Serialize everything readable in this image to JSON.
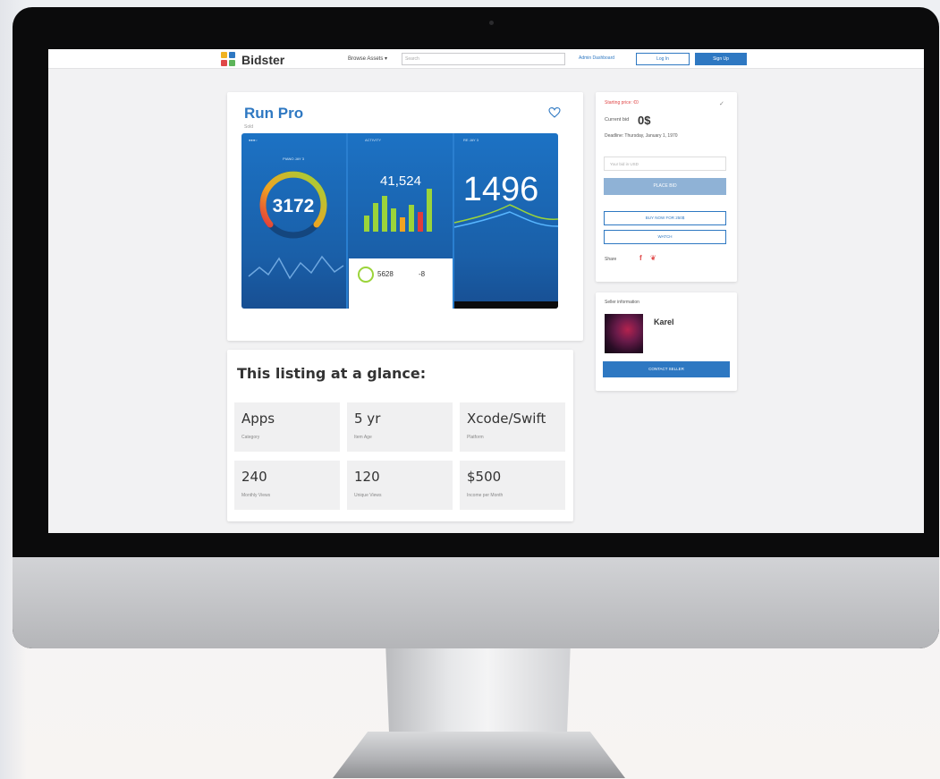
{
  "navbar": {
    "brand": "Bidster",
    "browse_label": "Browse Assets ▾",
    "search_placeholder": "Search",
    "admin_label": "Admin Dashboard",
    "login_label": "Log In",
    "signup_label": "Sign Up"
  },
  "listing": {
    "title": "Run Pro",
    "subtitle": "Sold",
    "hero": {
      "left_label": "●●●○",
      "left_caption": "PIANO  JAY 3",
      "gauge_value": "3172",
      "mid_label": "ACTIVITY",
      "mid_value": "41,524",
      "right_label": "RE  JAY 3",
      "right_value": "1496",
      "card_a": "5628",
      "card_b": "-8"
    }
  },
  "glance": {
    "title": "This listing at a glance:",
    "tiles": [
      {
        "value": "Apps",
        "label": "Category"
      },
      {
        "value": "5 yr",
        "label": "Item Age"
      },
      {
        "value": "Xcode/Swift",
        "label": "Platform"
      },
      {
        "value": "240",
        "label": "Monthly Views"
      },
      {
        "value": "120",
        "label": "Unique Views"
      },
      {
        "value": "$500",
        "label": "Income per Month"
      }
    ]
  },
  "bid": {
    "starting_price": "Starting price: €0",
    "current_label": "Current bid",
    "current_value": "0$",
    "deadline": "Deadline: Thursday, January 1, 1970",
    "input_placeholder": "Your bid in USD",
    "place_bid": "PLACE BID",
    "buy_now": "BUY NOW FOR 250$",
    "watch": "WATCH",
    "share_label": "Share"
  },
  "seller": {
    "section_label": "Seller information",
    "name": "Karel",
    "contact": "CONTACT SELLER"
  },
  "colors": {
    "accent": "#2e78c2",
    "danger": "#e04848",
    "hero_blue": "#1c72c4"
  }
}
